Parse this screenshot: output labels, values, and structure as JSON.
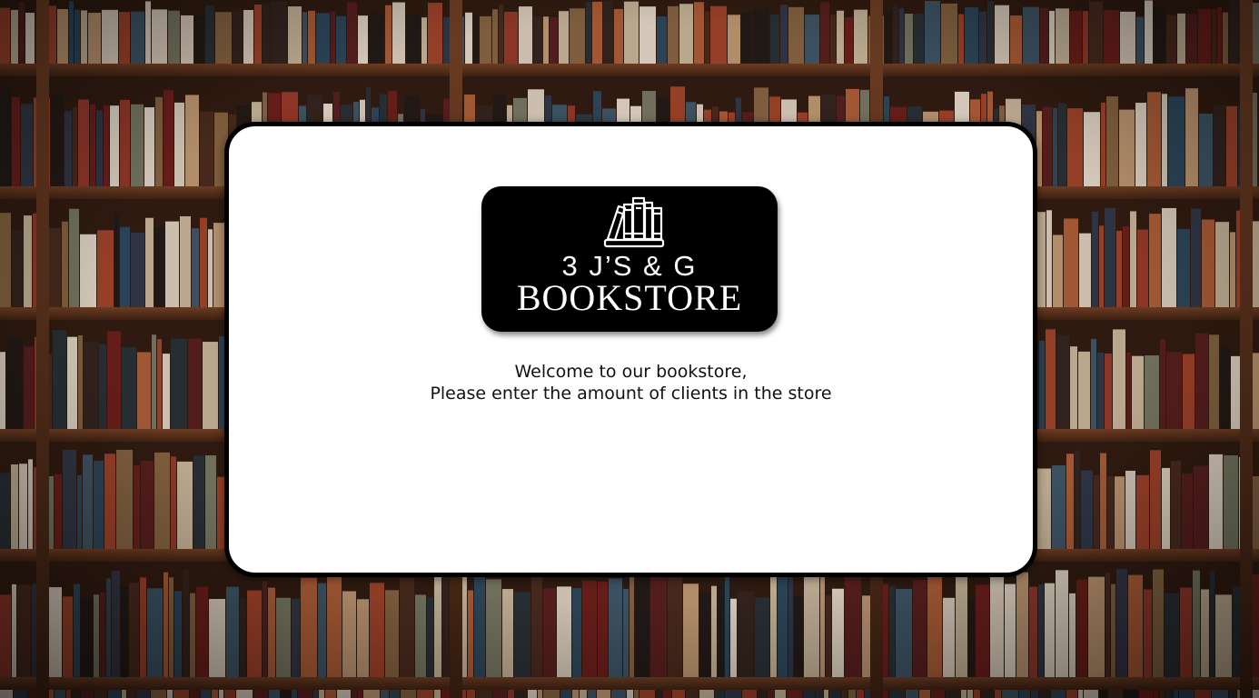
{
  "background": {
    "description_icon": "bookshelf-background"
  },
  "modal": {
    "logo": {
      "icon": "books-icon",
      "line1": "3 J’S & G",
      "line2": "BOOKSTORE"
    },
    "welcome_line1": "Welcome to our bookstore,",
    "welcome_line2": "Please enter the amount of clients in the store"
  },
  "colors": {
    "card_bg": "#ffffff",
    "card_border": "#000000",
    "logo_bg": "#000000",
    "logo_text": "#ffffff",
    "text": "#111111"
  }
}
